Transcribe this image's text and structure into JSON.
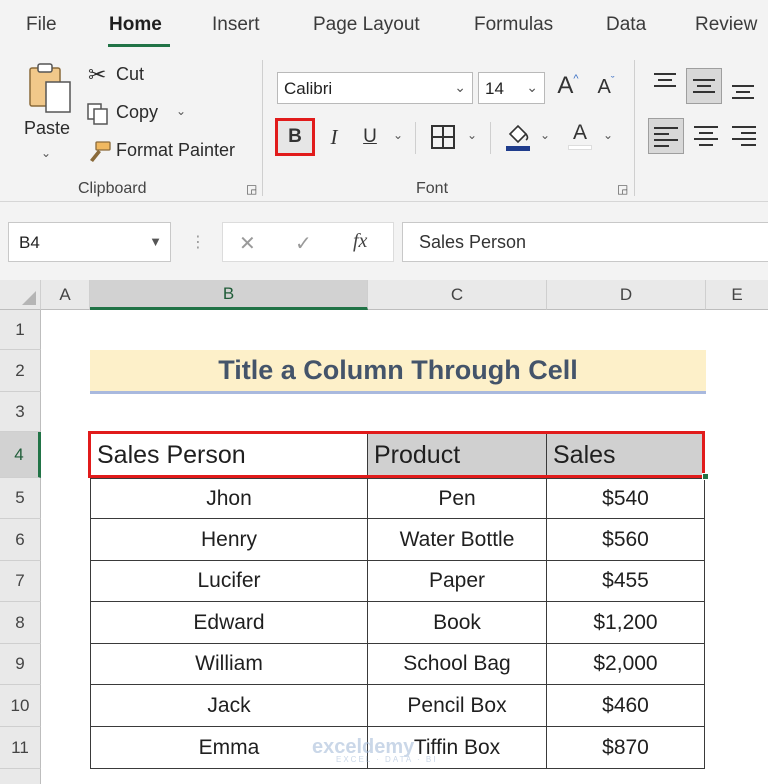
{
  "ribbon_tabs": [
    "File",
    "Home",
    "Insert",
    "Page Layout",
    "Formulas",
    "Data",
    "Review"
  ],
  "clipboard": {
    "paste_label": "Paste",
    "cut_label": "Cut",
    "copy_label": "Copy",
    "format_painter_label": "Format Painter",
    "group_label": "Clipboard"
  },
  "font": {
    "font_name": "Calibri",
    "font_size": "14",
    "bold_label": "B",
    "italic_label": "I",
    "underline_label": "U",
    "grow_label": "A",
    "shrink_label": "A",
    "font_color_label": "A",
    "group_label": "Font"
  },
  "formula_bar": {
    "name_box": "B4",
    "cancel_symbol": "✕",
    "enter_symbol": "✓",
    "fx_label": "fx",
    "formula": "Sales Person"
  },
  "sheet": {
    "columns": [
      "A",
      "B",
      "C",
      "D",
      "E"
    ],
    "rows": [
      "1",
      "2",
      "3",
      "4",
      "5",
      "6",
      "7",
      "8",
      "9",
      "10",
      "11"
    ],
    "title": "Title a Column Through Cell",
    "headers": [
      "Sales Person",
      "Product",
      "Sales"
    ],
    "data": [
      [
        "Jhon",
        "Pen",
        "$540"
      ],
      [
        "Henry",
        "Water Bottle",
        "$560"
      ],
      [
        "Lucifer",
        "Paper",
        "$455"
      ],
      [
        "Edward",
        "Book",
        "$1,200"
      ],
      [
        "William",
        "School Bag",
        "$2,000"
      ],
      [
        "Jack",
        "Pencil Box",
        "$460"
      ],
      [
        "Emma",
        "Tiffin Box",
        "$870"
      ]
    ]
  },
  "watermark": {
    "name": "exceldemy",
    "tagline": "EXCEL · DATA · BI"
  },
  "colors": {
    "accent_green": "#217346",
    "highlight_red": "#e11b1b",
    "title_fill": "#fdf0c9",
    "header_fill": "#d0d0d0"
  }
}
